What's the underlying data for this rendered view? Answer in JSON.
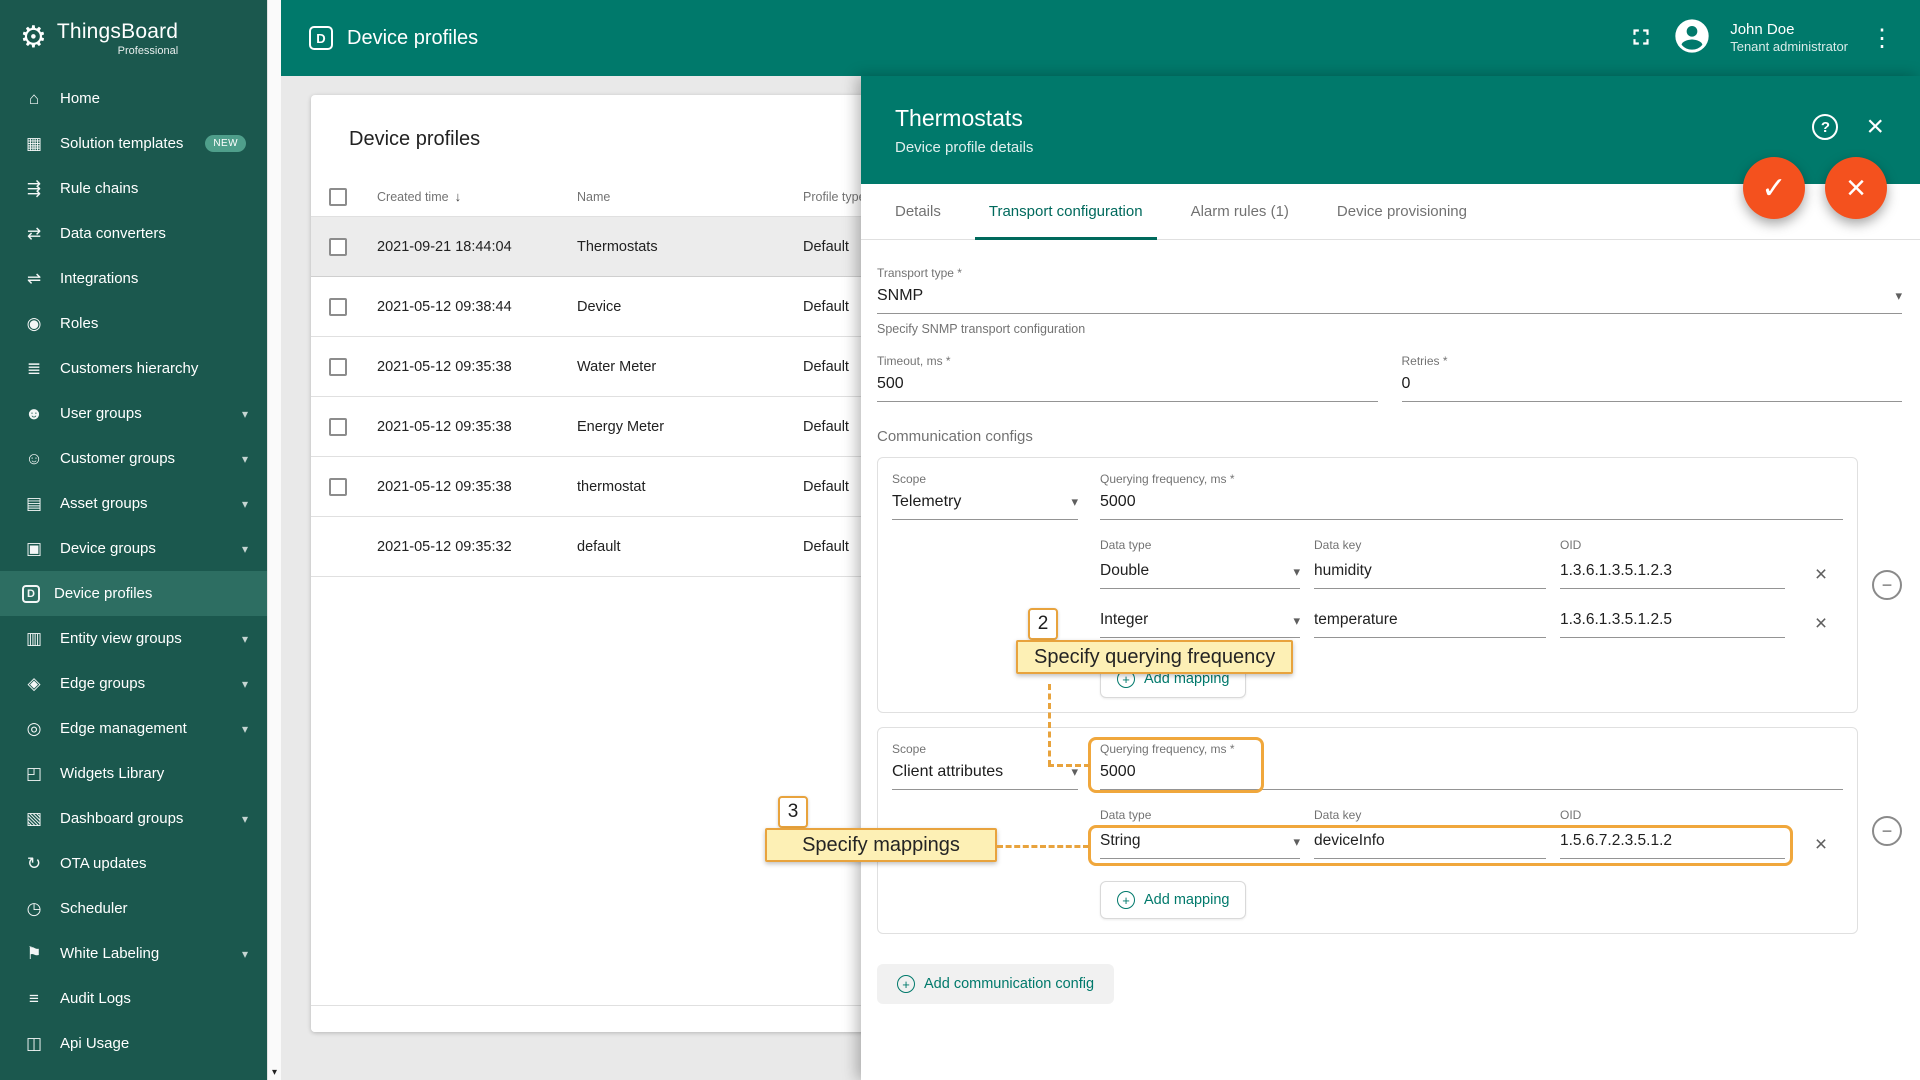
{
  "colors": {
    "primary": "#00796b",
    "primary_dark": "#00695c",
    "sidebar": "#1b584e",
    "sidebar_active": "#2d6e62",
    "accent": "#f4511e",
    "annotation": "#e8a33d",
    "callout_bg": "#fdf0b5",
    "highlight": "#f0a73c",
    "badge": "#4f9f8b"
  },
  "brand": {
    "name": "ThingsBoard",
    "subtitle": "Professional"
  },
  "appbar": {
    "title": "Device profiles",
    "user": {
      "name": "John Doe",
      "role": "Tenant administrator"
    }
  },
  "sidebar": {
    "items": [
      {
        "label": "Home",
        "icon": "home-icon"
      },
      {
        "label": "Solution templates",
        "icon": "solution-templates-icon",
        "badge": "NEW"
      },
      {
        "label": "Rule chains",
        "icon": "rule-chains-icon"
      },
      {
        "label": "Data converters",
        "icon": "data-converters-icon"
      },
      {
        "label": "Integrations",
        "icon": "integrations-icon"
      },
      {
        "label": "Roles",
        "icon": "roles-icon"
      },
      {
        "label": "Customers hierarchy",
        "icon": "customers-hierarchy-icon"
      },
      {
        "label": "User groups",
        "icon": "user-groups-icon",
        "expandable": true
      },
      {
        "label": "Customer groups",
        "icon": "customer-groups-icon",
        "expandable": true
      },
      {
        "label": "Asset groups",
        "icon": "asset-groups-icon",
        "expandable": true
      },
      {
        "label": "Device groups",
        "icon": "device-groups-icon",
        "expandable": true
      },
      {
        "label": "Device profiles",
        "icon": "device-profiles-icon",
        "active": true
      },
      {
        "label": "Entity view groups",
        "icon": "entity-view-groups-icon",
        "expandable": true
      },
      {
        "label": "Edge groups",
        "icon": "edge-groups-icon",
        "expandable": true
      },
      {
        "label": "Edge management",
        "icon": "edge-management-icon",
        "expandable": true
      },
      {
        "label": "Widgets Library",
        "icon": "widgets-library-icon"
      },
      {
        "label": "Dashboard groups",
        "icon": "dashboard-groups-icon",
        "expandable": true
      },
      {
        "label": "OTA updates",
        "icon": "ota-updates-icon"
      },
      {
        "label": "Scheduler",
        "icon": "scheduler-icon"
      },
      {
        "label": "White Labeling",
        "icon": "white-labeling-icon",
        "expandable": true
      },
      {
        "label": "Audit Logs",
        "icon": "audit-logs-icon"
      },
      {
        "label": "Api Usage",
        "icon": "api-usage-icon"
      }
    ]
  },
  "table": {
    "title": "Device profiles",
    "columns": {
      "created": "Created time",
      "name": "Name",
      "profile": "Profile type"
    },
    "rows": [
      {
        "created": "2021-09-21 18:44:04",
        "name": "Thermostats",
        "profile": "Default"
      },
      {
        "created": "2021-05-12 09:38:44",
        "name": "Device",
        "profile": "Default"
      },
      {
        "created": "2021-05-12 09:35:38",
        "name": "Water Meter",
        "profile": "Default"
      },
      {
        "created": "2021-05-12 09:35:38",
        "name": "Energy Meter",
        "profile": "Default"
      },
      {
        "created": "2021-05-12 09:35:38",
        "name": "thermostat",
        "profile": "Default"
      },
      {
        "created": "2021-05-12 09:35:32",
        "name": "default",
        "profile": "Default"
      }
    ]
  },
  "panel": {
    "title": "Thermostats",
    "subtitle": "Device profile details",
    "tabs": [
      {
        "label": "Details"
      },
      {
        "label": "Transport configuration"
      },
      {
        "label": "Alarm rules (1)"
      },
      {
        "label": "Device provisioning"
      }
    ],
    "transport_type": {
      "label": "Transport type *",
      "value": "SNMP"
    },
    "hint": "Specify SNMP transport configuration",
    "timeout": {
      "label": "Timeout, ms *",
      "value": "500"
    },
    "retries": {
      "label": "Retries *",
      "value": "0"
    },
    "section_label": "Communication configs",
    "configs": [
      {
        "scope_label": "Scope",
        "scope_value": "Telemetry",
        "freq_label": "Querying frequency, ms *",
        "freq_value": "5000",
        "headers": {
          "type": "Data type",
          "key": "Data key",
          "oid": "OID"
        },
        "mappings": [
          {
            "type": "Double",
            "key": "humidity",
            "oid": "1.3.6.1.3.5.1.2.3"
          },
          {
            "type": "Integer",
            "key": "temperature",
            "oid": "1.3.6.1.3.5.1.2.5"
          }
        ],
        "add_mapping_label": "Add mapping"
      },
      {
        "scope_label": "Scope",
        "scope_value": "Client attributes",
        "freq_label": "Querying frequency, ms *",
        "freq_value": "5000",
        "headers": {
          "type": "Data type",
          "key": "Data key",
          "oid": "OID"
        },
        "mappings": [
          {
            "type": "String",
            "key": "deviceInfo",
            "oid": "1.5.6.7.2.3.5.1.2"
          }
        ],
        "add_mapping_label": "Add mapping"
      }
    ],
    "add_config_label": "Add communication config"
  },
  "annotations": {
    "step2": {
      "number": "2",
      "text": "Specify querying frequency"
    },
    "step3": {
      "number": "3",
      "text": "Specify mappings"
    }
  }
}
